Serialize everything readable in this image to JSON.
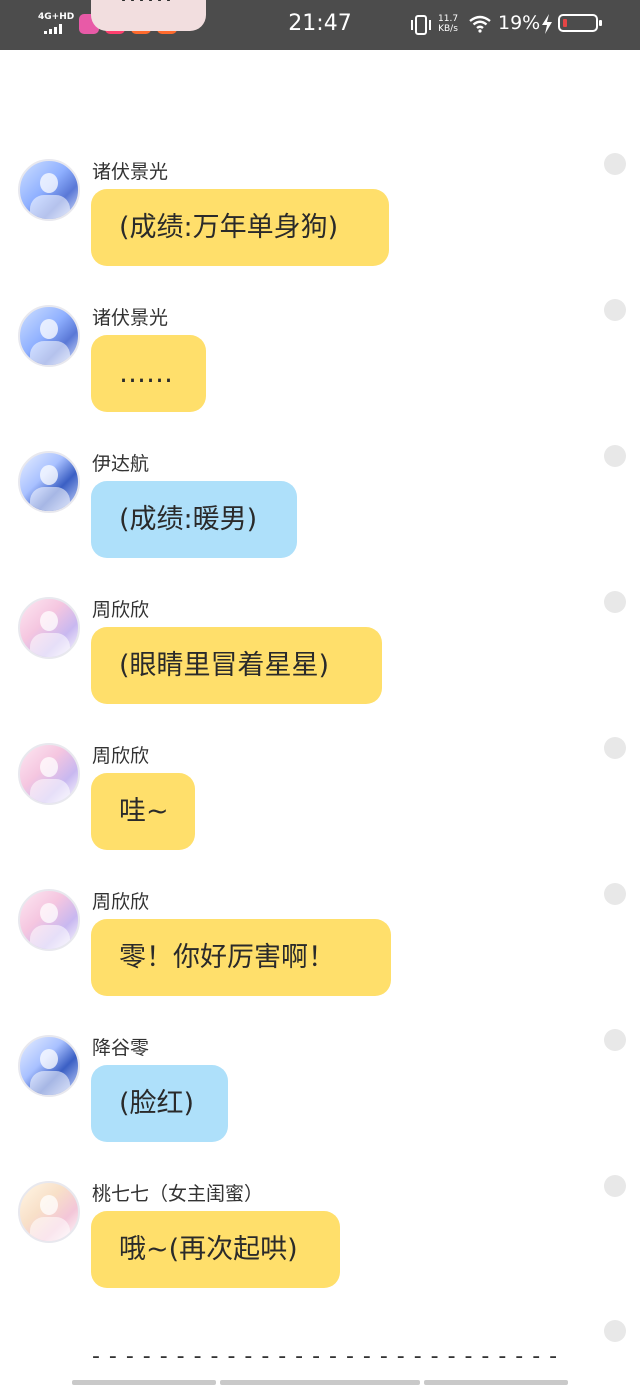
{
  "status_bar": {
    "network": "4G+HD",
    "time": "21:47",
    "speed_value": "11.7",
    "speed_unit": "KB/s",
    "battery_percent": "19%",
    "battery_level": 0.19
  },
  "messages": [
    {
      "name": "",
      "text": "……",
      "color": "#f2dedf",
      "avatar": "male"
    },
    {
      "name": "诸伏景光",
      "text": "(成绩:万年单身狗)",
      "color": "#ffdf6b",
      "avatar": "male"
    },
    {
      "name": "诸伏景光",
      "text": "……",
      "color": "#ffdf6b",
      "avatar": "male"
    },
    {
      "name": "伊达航",
      "text": "(成绩:暖男)",
      "color": "#aee0fa",
      "avatar": "male2"
    },
    {
      "name": "周欣欣",
      "text": "(眼睛里冒着星星)",
      "color": "#ffdf6b",
      "avatar": "female"
    },
    {
      "name": "周欣欣",
      "text": "哇~",
      "color": "#ffdf6b",
      "avatar": "female"
    },
    {
      "name": "周欣欣",
      "text": "零！你好厉害啊！",
      "color": "#ffdf6b",
      "avatar": "female"
    },
    {
      "name": "降谷零",
      "text": "(脸红)",
      "color": "#aee0fa",
      "avatar": "male2"
    },
    {
      "name": "桃七七（女主闺蜜）",
      "text": "哦~(再次起哄)",
      "color": "#ffdf6b",
      "avatar": "pink"
    }
  ],
  "divider_text": "- - - - - - - - - - - - - - - - - - - - - - - - - - - -"
}
